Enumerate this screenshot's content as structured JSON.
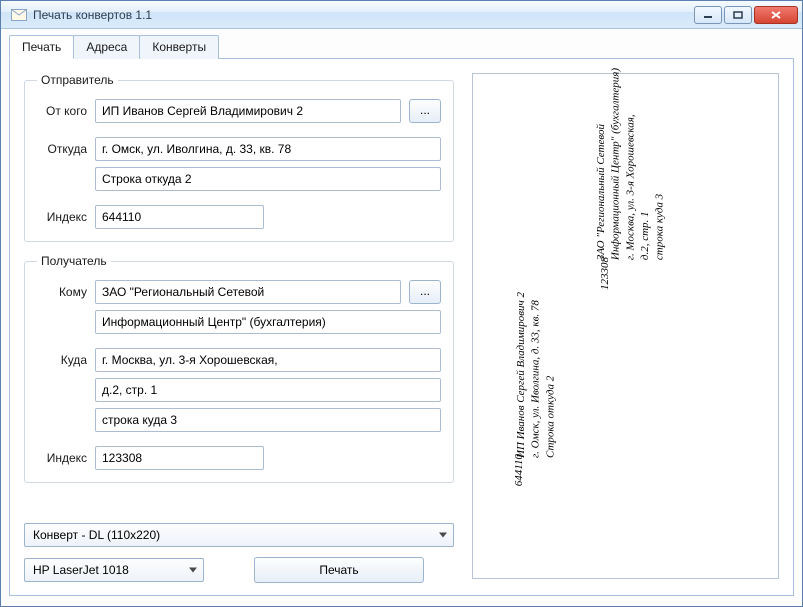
{
  "window": {
    "title": "Печать конвертов 1.1"
  },
  "tabs": {
    "print": "Печать",
    "addresses": "Адреса",
    "envelopes": "Конверты"
  },
  "sender": {
    "legend": "Отправитель",
    "from_label": "От кого",
    "from_value": "ИП Иванов Сергей Владимирович 2",
    "addr_label": "Откуда",
    "addr_line1": "г. Омск, ул. Иволгина, д. 33, кв. 78",
    "addr_line2": "Строка откуда 2",
    "index_label": "Индекс",
    "index_value": "644110",
    "browse_label": "..."
  },
  "recipient": {
    "legend": "Получатель",
    "to_label": "Кому",
    "to_line1": "ЗАО \"Региональный Сетевой",
    "to_line2": "Информационный Центр\" (бухгалтерия)",
    "addr_label": "Куда",
    "addr_line1": "г. Москва, ул. 3-я Хорошевская,",
    "addr_line2": "д.2, стр. 1",
    "addr_line3": "строка куда 3",
    "index_label": "Индекс",
    "index_value": "123308",
    "browse_label": "..."
  },
  "envelope_select": "Конверт - DL (110x220)",
  "printer_select": "HP LaserJet 1018",
  "print_button": "Печать",
  "preview": {
    "sender_lines": [
      "ИП Иванов Сергей Владимирович 2",
      "г. Омск, ул. Иволгина, д. 33, кв. 78",
      "Строка откуда 2"
    ],
    "sender_index": "644110",
    "recipient_lines": [
      "ЗАО \"Региональный Сетевой",
      "Информационный Центр\" (бухгалтерия)",
      "г. Москва, ул. 3-я Хорошевская,",
      "д.2, стр. 1",
      "строка куда 3"
    ],
    "recipient_index": "123308"
  }
}
